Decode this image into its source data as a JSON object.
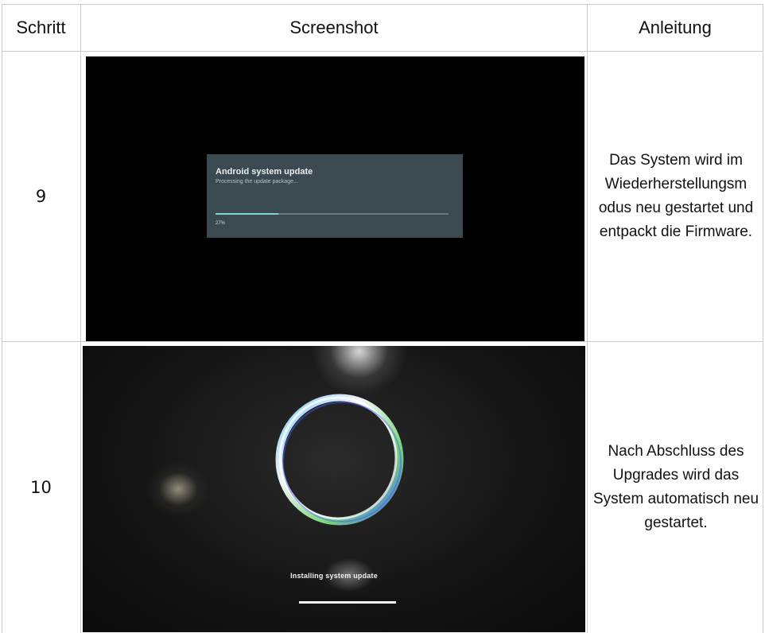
{
  "table": {
    "headers": {
      "step": "Schritt",
      "screenshot": "Screenshot",
      "instruction": "Anleitung"
    },
    "rows": [
      {
        "step": "9",
        "instruction": "Das System wird im Wiederherstellungsm odus neu gestartet und entpackt die Firmware.",
        "screenshot": {
          "dialog_title": "Android system update",
          "dialog_subtitle": "Processing the update package...",
          "progress_percent_label": "27%",
          "progress_fraction": 0.27
        }
      },
      {
        "step": "10",
        "instruction": "Nach Abschluss des Upgrades wird das System automatisch neu gestartet.",
        "screenshot": {
          "status_label": "Installing system update",
          "progress_fraction": 1.0
        }
      }
    ]
  },
  "colors": {
    "grid": "#c9c9c9",
    "dialog_bg": "#3b4a50",
    "progress_accent": "#7fd3cf"
  }
}
